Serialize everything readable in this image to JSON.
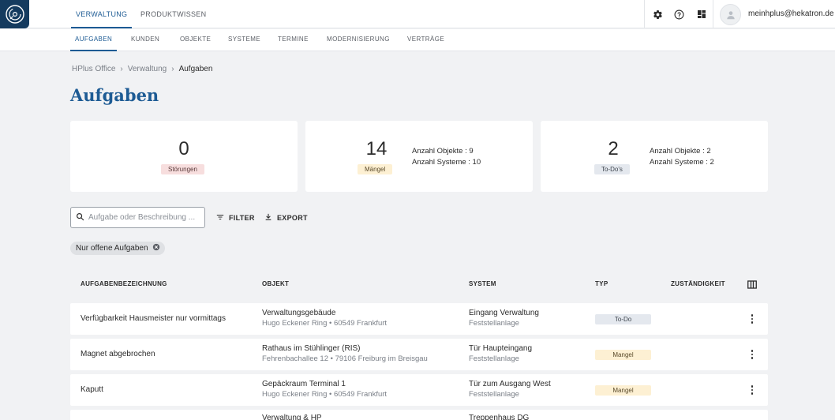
{
  "header": {
    "logo_icon": "hekatron-logo-icon",
    "tabs": [
      {
        "label": "VERWALTUNG",
        "active": true
      },
      {
        "label": "PRODUKTWISSEN",
        "active": false
      }
    ],
    "icons": [
      "settings-icon",
      "help-icon",
      "dashboard-icon"
    ],
    "user_email": "meinhplus@hekatron.de"
  },
  "subnav": {
    "tabs": [
      {
        "label": "AUFGABEN",
        "active": true
      },
      {
        "label": "KUNDEN",
        "active": false
      },
      {
        "label": "OBJEKTE",
        "active": false
      },
      {
        "label": "SYSTEME",
        "active": false
      },
      {
        "label": "TERMINE",
        "active": false
      },
      {
        "label": "MODERNISIERUNG",
        "active": false
      },
      {
        "label": "VERTRÄGE",
        "active": false
      }
    ]
  },
  "breadcrumb": [
    "HPlus Office",
    "Verwaltung",
    "Aufgaben"
  ],
  "page_title": "Aufgaben",
  "stats": [
    {
      "value": "0",
      "label": "Störungen",
      "meta": []
    },
    {
      "value": "14",
      "label": "Mängel",
      "meta": [
        "Anzahl Objekte : 9",
        "Anzahl Systeme : 10"
      ]
    },
    {
      "value": "2",
      "label": "To-Do's",
      "meta": [
        "Anzahl Objekte : 2",
        "Anzahl Systeme : 2"
      ]
    }
  ],
  "search": {
    "placeholder": "Aufgabe oder Beschreibung ...",
    "value": ""
  },
  "actions": {
    "filter_label": "FILTER",
    "export_label": "EXPORT"
  },
  "filter_chip": "Nur offene Aufgaben",
  "table": {
    "columns": [
      "AUFGABENBEZEICHNUNG",
      "OBJEKT",
      "SYSTEM",
      "TYP",
      "ZUSTÄNDIGKEIT"
    ],
    "rows": [
      {
        "task": "Verfügbarkeit Hausmeister nur vormittags",
        "object": "Verwaltungsgebäude",
        "address": "Hugo Eckener Ring • 60549 Frankfurt",
        "system": "Eingang Verwaltung",
        "system_type": "Feststellanlage",
        "type": "To-Do"
      },
      {
        "task": "Magnet abgebrochen",
        "object": "Rathaus im Stühlinger (RIS)",
        "address": "Fehrenbachallee 12 • 79106 Freiburg im Breisgau",
        "system": "Tür Haupteingang",
        "system_type": "Feststellanlage",
        "type": "Mangel"
      },
      {
        "task": "Kaputt",
        "object": "Gepäckraum Terminal 1",
        "address": "Hugo Eckener Ring • 60549 Frankfurt",
        "system": "Tür zum Ausgang West",
        "system_type": "Feststellanlage",
        "type": "Mangel"
      },
      {
        "task": "",
        "object": "Verwaltung & HP",
        "address": "",
        "system": "Treppenhaus DG",
        "system_type": "",
        "type": ""
      }
    ]
  },
  "colors": {
    "primary": "#1d5b94",
    "logo_bg": "#153b5f",
    "todo_bg": "#e4e8ee",
    "mangel_bg": "#fdf0d3",
    "stoerung_bg": "#f7dede"
  }
}
